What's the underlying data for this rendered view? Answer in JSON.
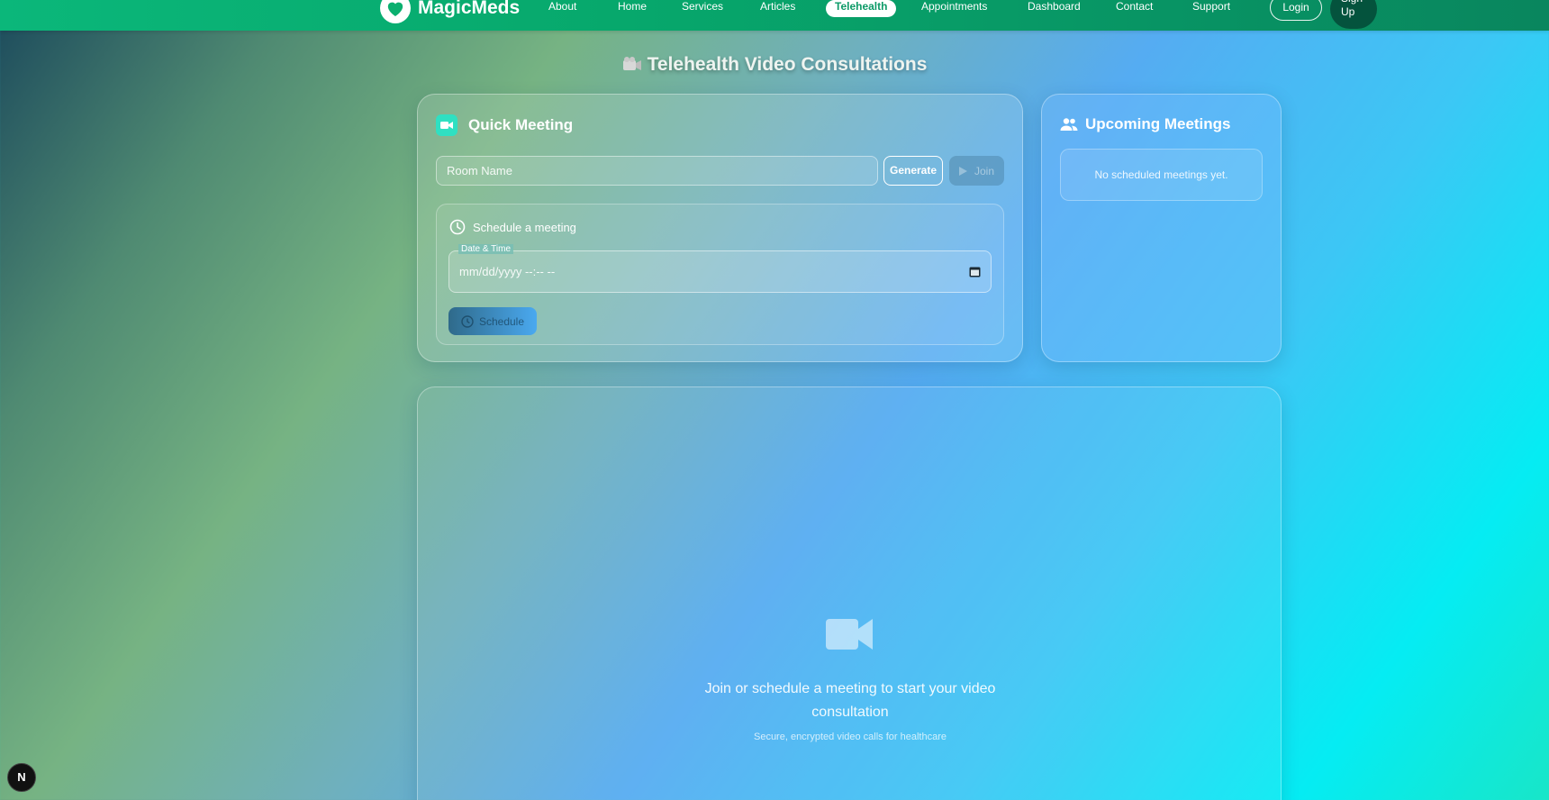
{
  "nav": {
    "brand": "MagicMeds",
    "links": [
      "About",
      "Home",
      "Services",
      "Articles",
      "Telehealth",
      "Appointments",
      "Dashboard",
      "Contact",
      "Support"
    ],
    "active": "Telehealth",
    "login": "Login",
    "signup": "Sign Up"
  },
  "page": {
    "title": "Telehealth Video Consultations"
  },
  "quick_meeting": {
    "heading": "Quick Meeting",
    "room_placeholder": "Room Name",
    "generate": "Generate",
    "join": "Join",
    "schedule": {
      "heading": "Schedule a meeting",
      "datetime_label": "Date & Time",
      "datetime_value": "mm/dd/yyyy --:-- --",
      "button": "Schedule"
    }
  },
  "upcoming": {
    "heading": "Upcoming Meetings",
    "empty": "No scheduled meetings yet."
  },
  "video": {
    "message": "Join or schedule a meeting to start your video consultation",
    "subtext": "Secure, encrypted video calls for healthcare"
  },
  "dev_badge": "N",
  "colors": {
    "nav": "#0bb77a",
    "accent_teal": "#2fe0c2",
    "signup_bg": "#04533d"
  }
}
